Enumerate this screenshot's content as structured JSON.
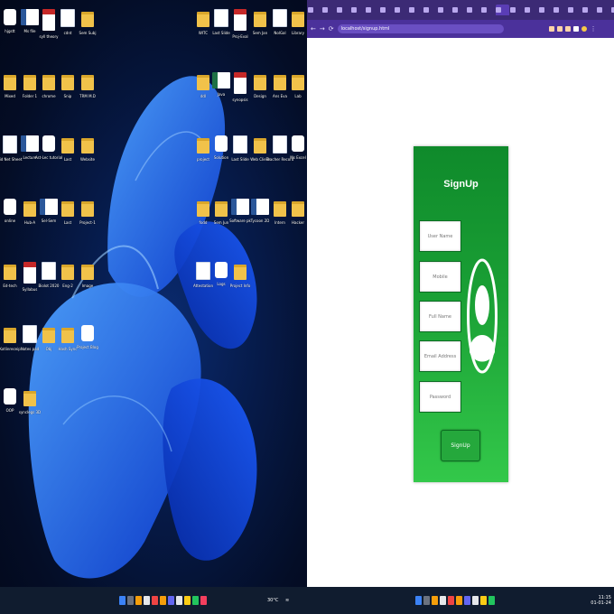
{
  "desktop": {
    "icons": [
      {
        "label": "hjgstt",
        "kind": "app"
      },
      {
        "label": "Ms file",
        "kind": "word"
      },
      {
        "label": "syll theory",
        "kind": "pdf"
      },
      {
        "label": "cdnt",
        "kind": "doc"
      },
      {
        "label": "Sem Subj",
        "kind": "folder"
      },
      {
        "label": "Mixed",
        "kind": "folder"
      },
      {
        "label": "Folder 1",
        "kind": "folder"
      },
      {
        "label": "chrome",
        "kind": "folder"
      },
      {
        "label": "Snip",
        "kind": "folder"
      },
      {
        "label": "TRM M.D",
        "kind": "folder"
      },
      {
        "label": "Fid Net Sheet",
        "kind": "doc"
      },
      {
        "label": "Lecture",
        "kind": "word"
      },
      {
        "label": "Ast-Lec tutorial",
        "kind": "app"
      },
      {
        "label": "Last",
        "kind": "folder"
      },
      {
        "label": "Website",
        "kind": "folder"
      },
      {
        "label": "online",
        "kind": "app"
      },
      {
        "label": "Hub-A",
        "kind": "folder"
      },
      {
        "label": "Sel-Sem",
        "kind": "word"
      },
      {
        "label": "Last",
        "kind": "folder"
      },
      {
        "label": "Project-1",
        "kind": "folder"
      },
      {
        "label": "Ed-tech",
        "kind": "folder"
      },
      {
        "label": "Syllabus",
        "kind": "pdf"
      },
      {
        "label": "Biolot 2020",
        "kind": "doc"
      },
      {
        "label": "Eng-2",
        "kind": "folder"
      },
      {
        "label": "Image",
        "kind": "folder"
      },
      {
        "label": "Kotlinreceip",
        "kind": "folder"
      },
      {
        "label": "Notes pad",
        "kind": "doc"
      },
      {
        "label": "Obj",
        "kind": "folder"
      },
      {
        "label": "Hash Sync",
        "kind": "folder"
      },
      {
        "label": "Project Blog",
        "kind": "app"
      },
      {
        "label": "OOP",
        "kind": "app"
      },
      {
        "label": "synclegs 3D",
        "kind": "folder"
      }
    ],
    "icons_col2": [
      {
        "label": "WITC",
        "kind": "folder"
      },
      {
        "label": "Last Slide",
        "kind": "doc"
      },
      {
        "label": "Proj-Eval",
        "kind": "pdf"
      },
      {
        "label": "Sem Jan",
        "kind": "folder"
      },
      {
        "label": "NolGal",
        "kind": "doc"
      },
      {
        "label": "Library",
        "kind": "folder"
      },
      {
        "label": "ddl",
        "kind": "folder"
      },
      {
        "label": "Java",
        "kind": "excel"
      },
      {
        "label": "synopsis",
        "kind": "pdf"
      },
      {
        "label": "Design",
        "kind": "folder"
      },
      {
        "label": "Ans Eva",
        "kind": "folder"
      },
      {
        "label": "Lab",
        "kind": "folder"
      },
      {
        "label": "project",
        "kind": "folder"
      },
      {
        "label": "Solution",
        "kind": "app"
      },
      {
        "label": "Last Slide",
        "kind": "doc"
      },
      {
        "label": "Web Client",
        "kind": "folder"
      },
      {
        "label": "Teacher Record",
        "kind": "doc"
      },
      {
        "label": "Ms Excel",
        "kind": "app"
      },
      {
        "label": "fodd",
        "kind": "folder"
      },
      {
        "label": "Sem Jun",
        "kind": "folder"
      },
      {
        "label": "Software pk",
        "kind": "word"
      },
      {
        "label": "Tycoon 2D",
        "kind": "word"
      },
      {
        "label": "Intern",
        "kind": "folder"
      },
      {
        "label": "Hacker",
        "kind": "folder"
      },
      {
        "label": "Attestation",
        "kind": "doc"
      },
      {
        "label": "Logs",
        "kind": "app"
      },
      {
        "label": "Project Info",
        "kind": "folder"
      }
    ]
  },
  "browser": {
    "url": "localhost/signup.html",
    "tab_count": 24,
    "nav": {
      "back": "←",
      "forward": "→",
      "reload": "⟳"
    },
    "window_controls": {
      "minimize": "–",
      "maximize": "▢",
      "close": "✕"
    },
    "new_tab": "+"
  },
  "signup": {
    "title": "SignUp",
    "fields": [
      {
        "placeholder": "User Name"
      },
      {
        "placeholder": "Mobile"
      },
      {
        "placeholder": "Full Name"
      },
      {
        "placeholder": "Email Address"
      },
      {
        "placeholder": "Password"
      }
    ],
    "submit_label": "SignUp"
  },
  "taskbar": {
    "weather": "30°C",
    "clock_time": "11:15",
    "clock_date": "01-01-24"
  },
  "colors": {
    "card_top": "#0f8a2b",
    "card_bottom": "#33c84a",
    "browser_frame": "#3c2a75",
    "taskbar": "#101c2f"
  }
}
